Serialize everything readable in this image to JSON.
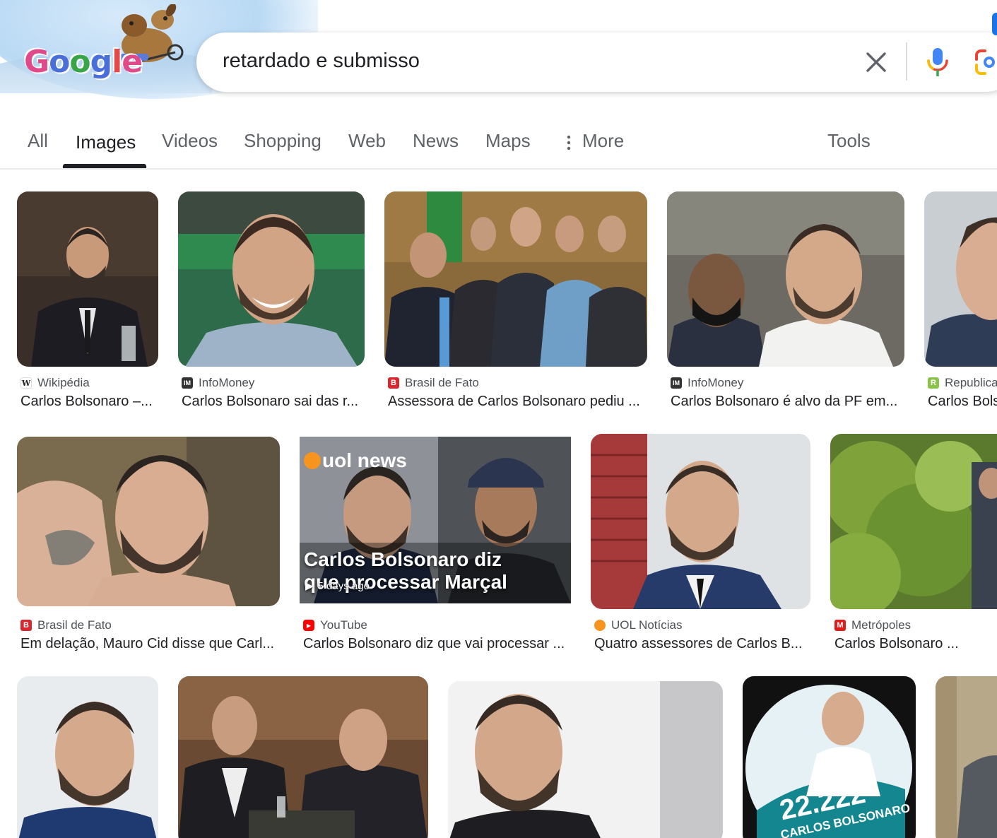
{
  "search": {
    "query": "retardado e submisso",
    "logo_letters": [
      "G",
      "o",
      "o",
      "g",
      "l",
      "e"
    ]
  },
  "tabs": [
    {
      "label": "All",
      "active": false
    },
    {
      "label": "Images",
      "active": true
    },
    {
      "label": "Videos",
      "active": false
    },
    {
      "label": "Shopping",
      "active": false
    },
    {
      "label": "Web",
      "active": false
    },
    {
      "label": "News",
      "active": false
    },
    {
      "label": "Maps",
      "active": false
    },
    {
      "label": "More",
      "active": false
    }
  ],
  "tools_label": "Tools",
  "results": [
    {
      "source": "Wikipédia",
      "favicon": "W",
      "favicon_color": "#ffffff",
      "title": "Carlos Bolsonaro –..."
    },
    {
      "source": "InfoMoney",
      "favicon": "IM",
      "favicon_color": "#333333",
      "title": "Carlos Bolsonaro sai das r..."
    },
    {
      "source": "Brasil de Fato",
      "favicon": "B",
      "favicon_color": "#d7282f",
      "title": "Assessora de Carlos Bolsonaro pediu ..."
    },
    {
      "source": "InfoMoney",
      "favicon": "IM",
      "favicon_color": "#333333",
      "title": "Carlos Bolsonaro é alvo da PF em..."
    },
    {
      "source": "Republica",
      "favicon": "R",
      "favicon_color": "#8bc34a",
      "title": "Carlos Bols"
    },
    {
      "source": "Brasil de Fato",
      "favicon": "B",
      "favicon_color": "#d7282f",
      "title": "Em delação, Mauro Cid disse que Carl..."
    },
    {
      "source": "YouTube",
      "favicon": "▶",
      "favicon_color": "#ff0000",
      "title": "Carlos Bolsonaro diz que vai processar ...",
      "overlay_title": "Carlos Bolsonaro diz que processar Marçal",
      "overlay_line1": "Carlos Bolsonaro diz",
      "overlay_line2": "que processar Marçal",
      "age": "5 days ago",
      "channel_logo": "uol news"
    },
    {
      "source": "UOL Notícias",
      "favicon": "●",
      "favicon_color": "#f7941d",
      "title": "Quatro assessores de Carlos B..."
    },
    {
      "source": "Metrópoles",
      "favicon": "M",
      "favicon_color": "#e21b1b",
      "title": "Carlos Bolsonaro ..."
    }
  ],
  "poster": {
    "number": "22.222",
    "name": "CARLOS BOLSONARO"
  }
}
